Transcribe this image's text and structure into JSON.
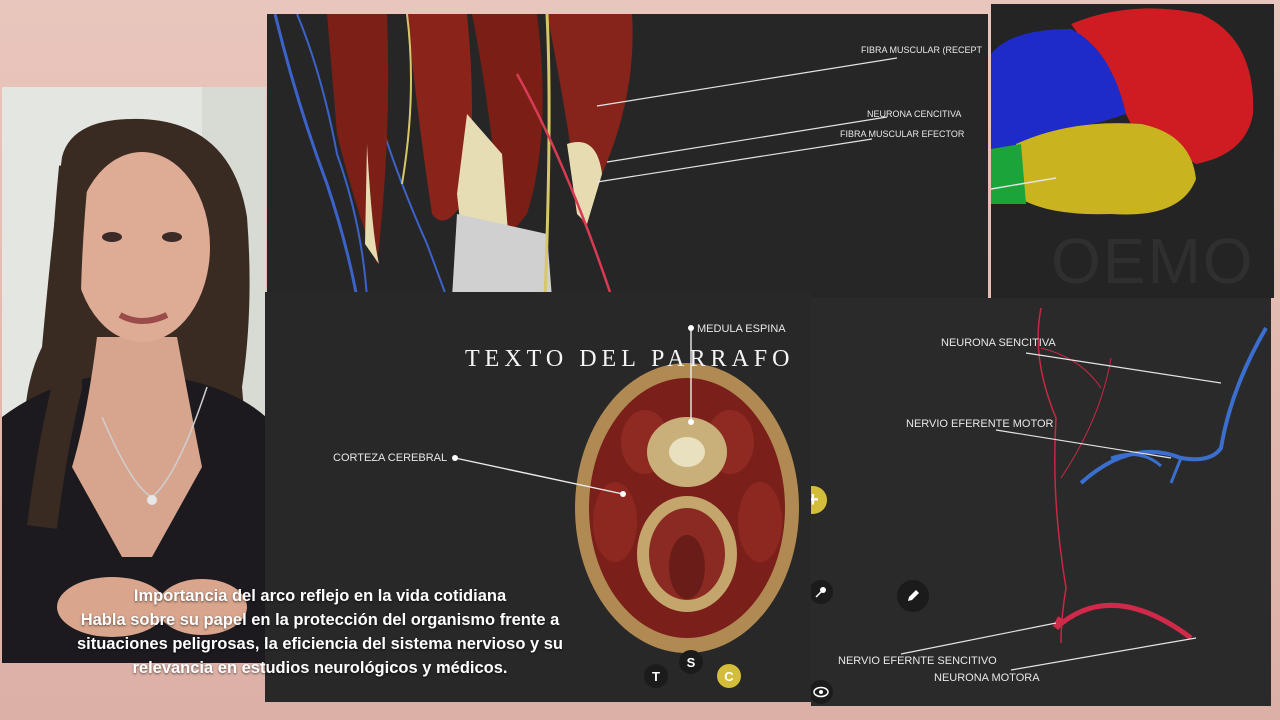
{
  "muscle_view": {
    "labels": [
      "FIBRA MUSCULAR (RECEPT",
      "NEURONA CENCITIVA",
      "FIBRA MUSCULAR EFECTOR"
    ]
  },
  "cross_section": {
    "title": "TEXTO DEL PARRAFO",
    "labels": [
      "MEDULA ESPINA",
      "CORTEZA CEREBRAL"
    ],
    "tools": {
      "t": "T",
      "s": "S",
      "c": "C"
    },
    "icons": [
      "add-icon",
      "pin-icon",
      "pencil-icon",
      "eye-icon"
    ]
  },
  "nerves_view": {
    "labels": [
      "NEURONA SENCITIVA",
      "NERVIO EFERENTE MOTOR",
      "NERVIO EFERNTE SENCITIVO",
      "NEURONA MOTORA"
    ]
  },
  "brain_view": {
    "watermark": "OEMO",
    "lobe_colors": {
      "frontal": "#1f2bc9",
      "parietal": "#cf1c22",
      "temporal": "#c9b31f",
      "other": "#1aa43a"
    }
  },
  "caption": {
    "line1": "Importancia del arco reflejo en la vida cotidiana",
    "line2": "Habla sobre su papel en la protección del organismo frente a",
    "line3": "situaciones peligrosas, la eficiencia del sistema nervioso y su",
    "line4": "relevancia en estudios neurológicos y médicos."
  }
}
